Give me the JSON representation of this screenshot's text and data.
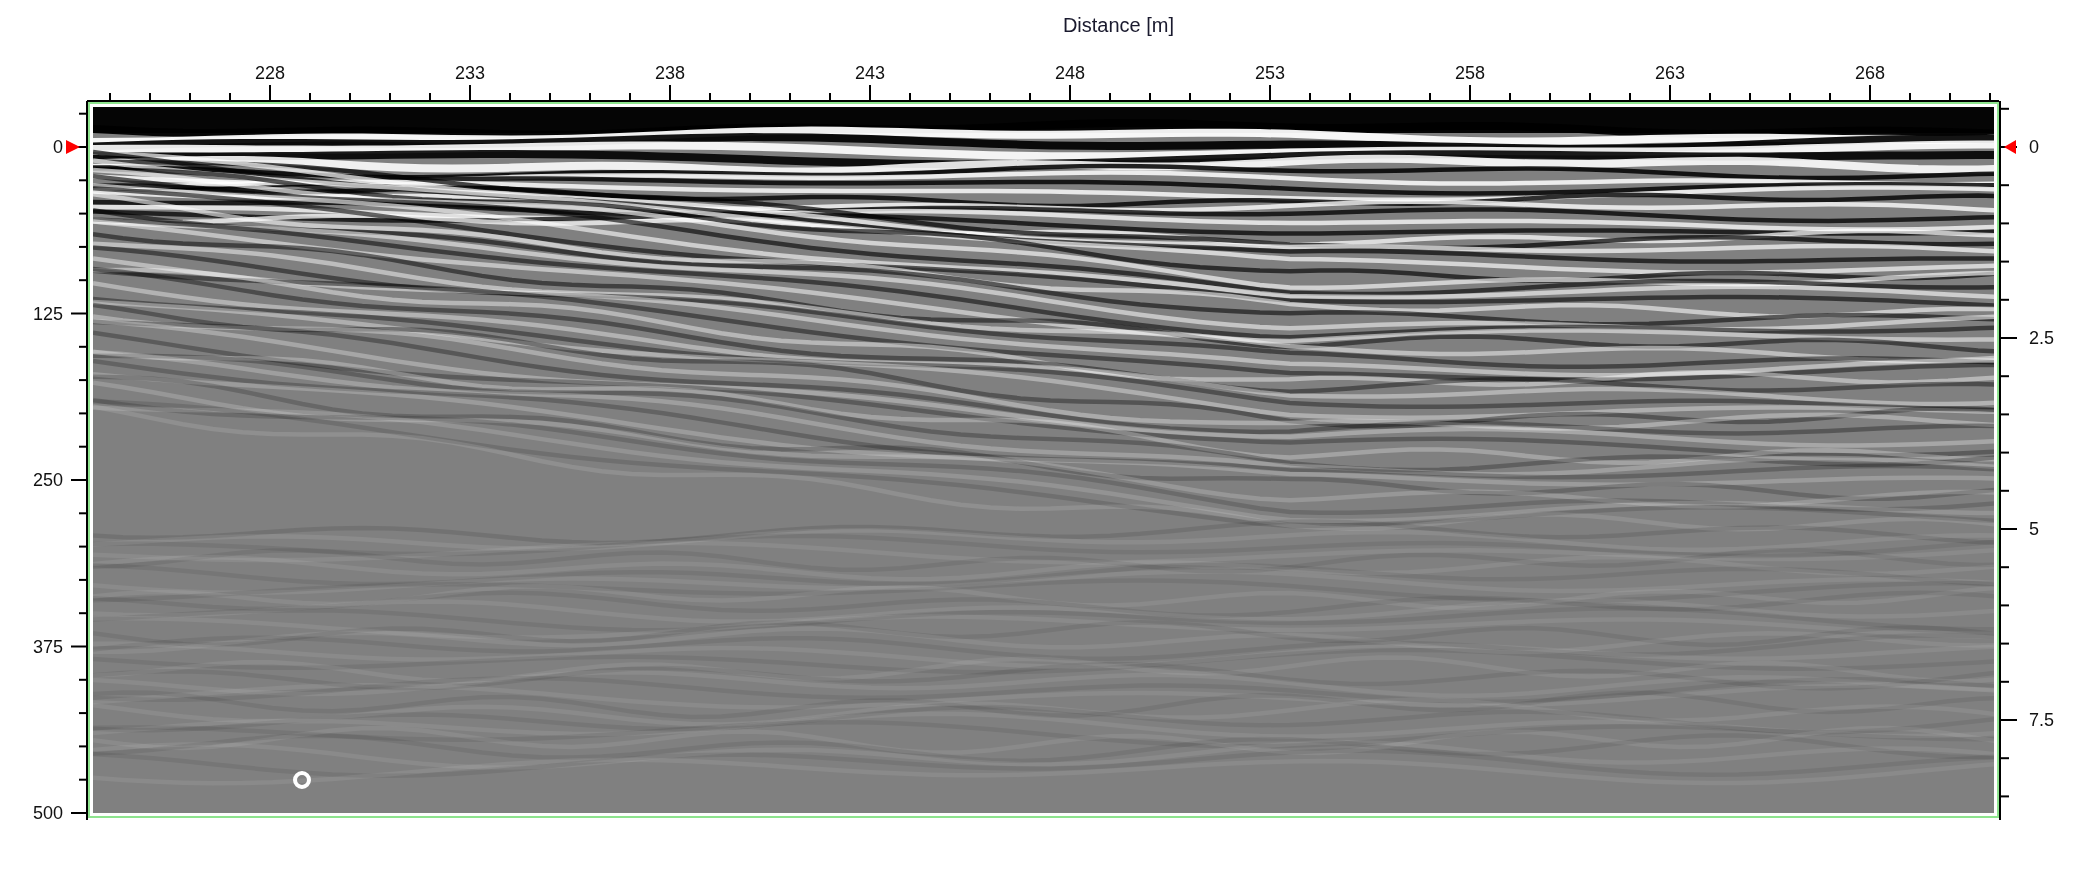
{
  "chart": {
    "xlabel": "Distance [m]",
    "xticks": [
      "228",
      "233",
      "238",
      "243",
      "248",
      "253",
      "258",
      "263",
      "268"
    ],
    "left_ticks": [
      "0",
      "125",
      "250",
      "375",
      "500"
    ],
    "right_ticks": [
      "0",
      "2.5",
      "5",
      "7.5"
    ]
  }
}
